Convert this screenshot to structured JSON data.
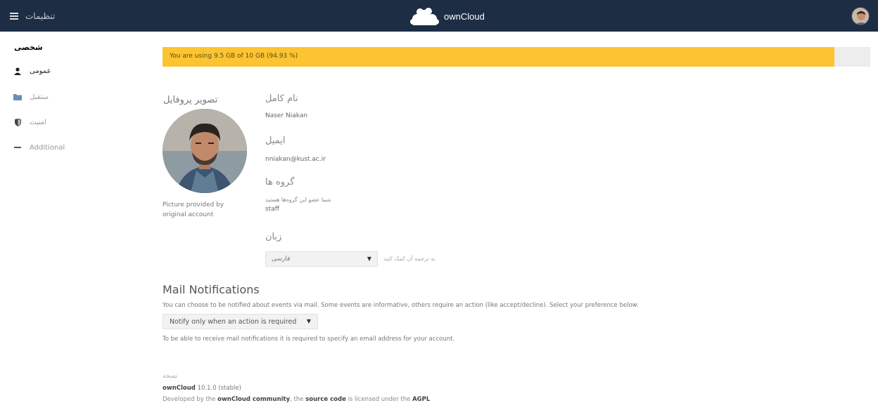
{
  "header": {
    "app_name": "تنظیمات",
    "brand_name": "ownCloud"
  },
  "sidebar": {
    "heading": "شخصی",
    "items": [
      {
        "label": "عمومی",
        "icon": "user-icon"
      },
      {
        "label": "ستقبل",
        "icon": "folder-icon"
      },
      {
        "label": "امنیت",
        "icon": "shield-icon"
      },
      {
        "label": "Additional",
        "icon": "dash-icon"
      }
    ]
  },
  "quota": {
    "text": "You are using 9.5 GB of 10 GB (94.93 %)",
    "percent": 94.93,
    "color": "#fcc431"
  },
  "profile": {
    "picture_title": "تصویر پروفایل",
    "picture_note": "Picture provided by original account",
    "fullname_label": "نام کامل",
    "fullname_value": "Naser Niakan",
    "email_label": "ایمیل",
    "email_value": "nniakan@kust.ac.ir",
    "groups_label": "گروه ها",
    "groups_note": "شما عضو این گروه‌ها هستید",
    "groups_value": "staff",
    "language_label": "زبان",
    "language_value": "فارسی",
    "language_help": "به ترجمه آن کمک کنید"
  },
  "mail": {
    "title": "Mail Notifications",
    "description": "You can choose to be notified about events via mail. Some events are informative, others require an action (like accept/decline). Select your preference below:",
    "selected": "Notify only when an action is required",
    "note": "To be able to receive mail notifications it is required to specify an email address for your account."
  },
  "version": {
    "title": "نسخه",
    "product": "ownCloud",
    "number": "10.1.0 (stable)",
    "dev_prefix": "Developed by the",
    "community": "ownCloud community",
    "dev_mid": ", the",
    "source": "source code",
    "dev_suffix": "is licensed under the",
    "license": "AGPL"
  },
  "colors": {
    "header_bg": "#1d2d44",
    "quota_fill": "#fcc431"
  }
}
